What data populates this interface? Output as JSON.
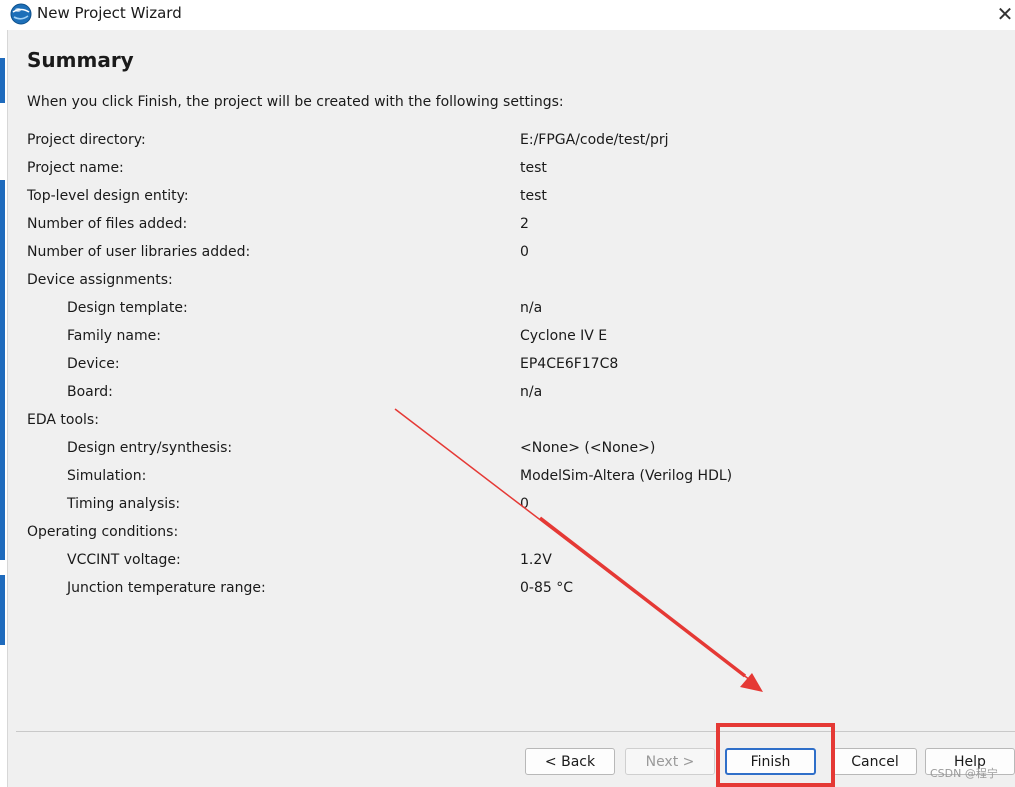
{
  "window": {
    "title": "New Project Wizard",
    "close_glyph": "✕",
    "app_icon": "quartus-globe-icon"
  },
  "page": {
    "heading": "Summary",
    "intro": "When you click Finish, the project will be created with the following settings:"
  },
  "settings": {
    "project_directory": {
      "label": "Project directory:",
      "value": "E:/FPGA/code/test/prj"
    },
    "project_name": {
      "label": "Project name:",
      "value": "test"
    },
    "top_level_entity": {
      "label": "Top-level design entity:",
      "value": "test"
    },
    "files_added": {
      "label": "Number of files added:",
      "value": "2"
    },
    "user_libraries_added": {
      "label": "Number of user libraries added:",
      "value": "0"
    },
    "device_assignments": {
      "label": "Device assignments:"
    },
    "design_template": {
      "label": "Design template:",
      "value": "n/a"
    },
    "family_name": {
      "label": "Family name:",
      "value": "Cyclone IV E"
    },
    "device": {
      "label": "Device:",
      "value": "EP4CE6F17C8"
    },
    "board": {
      "label": "Board:",
      "value": "n/a"
    },
    "eda_tools": {
      "label": "EDA tools:"
    },
    "design_entry_synthesis": {
      "label": "Design entry/synthesis:",
      "value": "<None> (<None>)"
    },
    "simulation": {
      "label": "Simulation:",
      "value": "ModelSim-Altera (Verilog HDL)"
    },
    "timing_analysis": {
      "label": "Timing analysis:",
      "value": "0"
    },
    "operating_conditions": {
      "label": "Operating conditions:"
    },
    "vccint_voltage": {
      "label": "VCCINT voltage:",
      "value": "1.2V"
    },
    "junction_temperature": {
      "label": "Junction temperature range:",
      "value": "0-85 °C"
    }
  },
  "buttons": {
    "back": "< Back",
    "next": "Next >",
    "finish": "Finish",
    "cancel": "Cancel",
    "help": "Help"
  },
  "annotation": {
    "color": "#e53935"
  },
  "watermark": "CSDN @程宁"
}
